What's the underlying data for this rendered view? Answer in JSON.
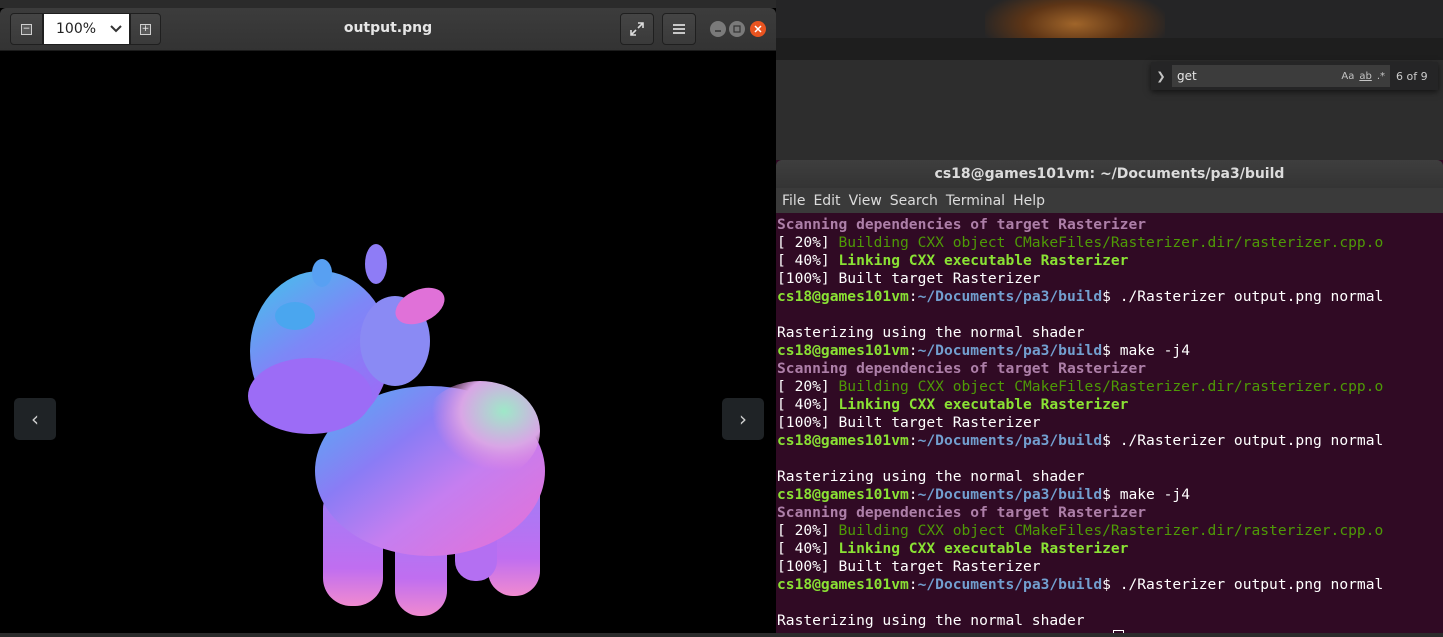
{
  "viewer": {
    "title": "output.png",
    "zoom_value": "100%",
    "zoom_out_glyph": "−",
    "zoom_in_glyph": "+",
    "prev_glyph": "‹",
    "next_glyph": "›",
    "icons": {
      "zoom_out": "zoom-out-icon",
      "zoom_in": "zoom-in-icon",
      "fullscreen": "fullscreen-icon",
      "menu": "hamburger-menu-icon",
      "prev": "chevron-left-icon",
      "next": "chevron-right-icon"
    },
    "image_subject": "normal-shaded cow model render"
  },
  "find_widget": {
    "query": "get",
    "match_case": "Aa",
    "whole_word": "ab",
    "regex": ".*",
    "result_count": "6 of 9"
  },
  "terminal": {
    "title": "cs18@games101vm: ~/Documents/pa3/build",
    "menu": [
      "File",
      "Edit",
      "View",
      "Search",
      "Terminal",
      "Help"
    ],
    "prompt_user": "cs18@games101vm",
    "prompt_path": "~/Documents/pa3/build",
    "lines": [
      {
        "type": "scan",
        "text": "Scanning dependencies of target Rasterizer"
      },
      {
        "type": "build",
        "pct": "[ 20%] ",
        "text": "Building CXX object CMakeFiles/Rasterizer.dir/rasterizer.cpp.o"
      },
      {
        "type": "link",
        "pct": "[ 40%] ",
        "text": "Linking CXX executable Rasterizer"
      },
      {
        "type": "plain",
        "text": "[100%] Built target Rasterizer"
      },
      {
        "type": "prompt",
        "cmd": " ./Rasterizer output.png normal"
      },
      {
        "type": "plain",
        "text": ""
      },
      {
        "type": "plain",
        "text": "Rasterizing using the normal shader"
      },
      {
        "type": "prompt",
        "cmd": " make -j4"
      },
      {
        "type": "scan",
        "text": "Scanning dependencies of target Rasterizer"
      },
      {
        "type": "build",
        "pct": "[ 20%] ",
        "text": "Building CXX object CMakeFiles/Rasterizer.dir/rasterizer.cpp.o"
      },
      {
        "type": "link",
        "pct": "[ 40%] ",
        "text": "Linking CXX executable Rasterizer"
      },
      {
        "type": "plain",
        "text": "[100%] Built target Rasterizer"
      },
      {
        "type": "prompt",
        "cmd": " ./Rasterizer output.png normal"
      },
      {
        "type": "plain",
        "text": ""
      },
      {
        "type": "plain",
        "text": "Rasterizing using the normal shader"
      },
      {
        "type": "prompt",
        "cmd": " make -j4"
      },
      {
        "type": "scan",
        "text": "Scanning dependencies of target Rasterizer"
      },
      {
        "type": "build",
        "pct": "[ 20%] ",
        "text": "Building CXX object CMakeFiles/Rasterizer.dir/rasterizer.cpp.o"
      },
      {
        "type": "link",
        "pct": "[ 40%] ",
        "text": "Linking CXX executable Rasterizer"
      },
      {
        "type": "plain",
        "text": "[100%] Built target Rasterizer"
      },
      {
        "type": "prompt",
        "cmd": " ./Rasterizer output.png normal"
      },
      {
        "type": "plain",
        "text": ""
      },
      {
        "type": "plain",
        "text": "Rasterizing using the normal shader"
      },
      {
        "type": "prompt-cursor",
        "cmd": ""
      }
    ],
    "colors": {
      "background": "#300a24",
      "prompt_user": "#8ae234",
      "prompt_path": "#729fcf",
      "scan": "#ad7fa8",
      "build": "#4e9a06"
    }
  }
}
